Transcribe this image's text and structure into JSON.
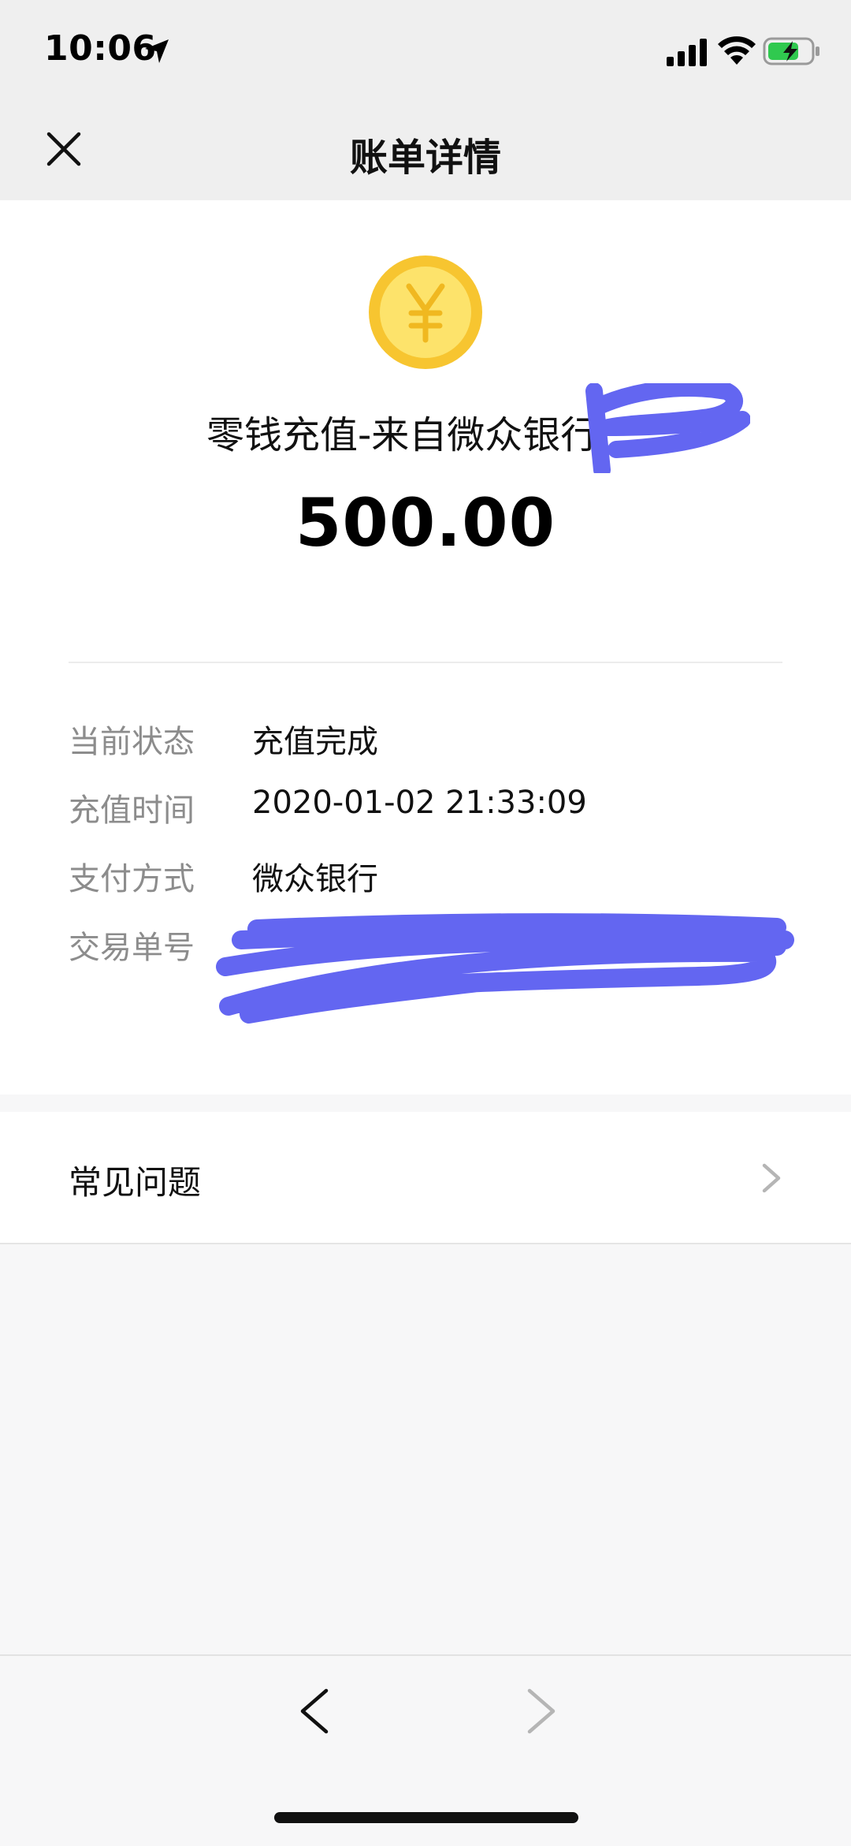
{
  "status_bar": {
    "time": "10:06",
    "icons": [
      "location-arrow-icon",
      "cellular-signal-icon",
      "wifi-icon",
      "battery-charging-icon"
    ]
  },
  "nav": {
    "title": "账单详情",
    "close_icon": "close-icon"
  },
  "bill": {
    "title": "零钱充值-来自微众银行(",
    "amount": "500.00",
    "coin_icon": "yuan-coin-icon",
    "colors": {
      "coin_outer": "#f7c530",
      "coin_inner": "#fde36b",
      "redaction": "#6366f1"
    }
  },
  "details": [
    {
      "label": "当前状态",
      "value": "充值完成"
    },
    {
      "label": "充值时间",
      "value": "2020-01-02 21:33:09"
    },
    {
      "label": "支付方式",
      "value": "微众银行"
    },
    {
      "label": "交易单号",
      "value": ""
    }
  ],
  "faq": {
    "label": "常见问题",
    "chevron_icon": "chevron-right-icon"
  },
  "bottom_bar": {
    "back_icon": "chevron-left-icon",
    "forward_icon": "chevron-right-icon"
  }
}
